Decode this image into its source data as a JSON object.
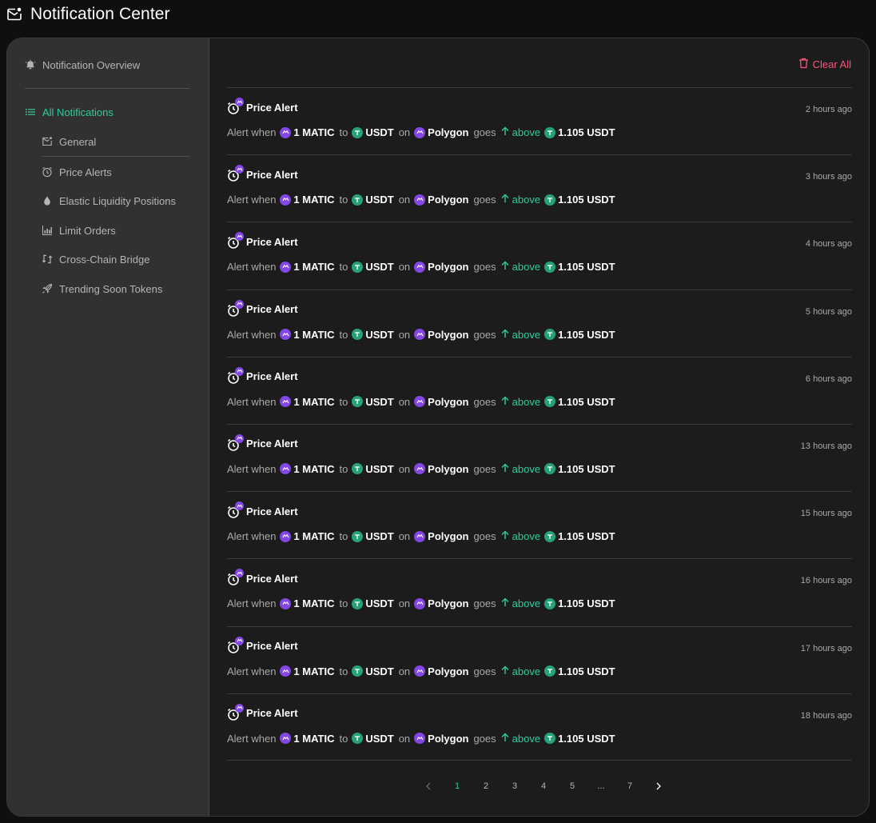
{
  "header": {
    "title": "Notification Center",
    "icon": "mail-badge-icon"
  },
  "sidebar": {
    "overview": {
      "label": "Notification Overview",
      "icon": "bell-icon"
    },
    "all": {
      "label": "All Notifications",
      "icon": "list-icon"
    },
    "items": [
      {
        "label": "General",
        "icon": "mail-icon"
      },
      {
        "label": "Price Alerts",
        "icon": "alarm-icon"
      },
      {
        "label": "Elastic Liquidity Positions",
        "icon": "drop-icon"
      },
      {
        "label": "Limit Orders",
        "icon": "chart-icon"
      },
      {
        "label": "Cross-Chain Bridge",
        "icon": "bridge-icon"
      },
      {
        "label": "Trending Soon Tokens",
        "icon": "rocket-icon"
      }
    ]
  },
  "toolbar": {
    "clear_all": "Clear All"
  },
  "alert_template": {
    "title": "Price Alert",
    "prefix": "Alert when",
    "amount": "1 MATIC",
    "to": "to",
    "quote": "USDT",
    "on": "on",
    "chain": "Polygon",
    "goes": "goes",
    "direction": "above",
    "target": "1.105 USDT"
  },
  "notifications": [
    {
      "time": "2 hours ago"
    },
    {
      "time": "3 hours ago"
    },
    {
      "time": "4 hours ago"
    },
    {
      "time": "5 hours ago"
    },
    {
      "time": "6 hours ago"
    },
    {
      "time": "13 hours ago"
    },
    {
      "time": "15 hours ago"
    },
    {
      "time": "16 hours ago"
    },
    {
      "time": "17 hours ago"
    },
    {
      "time": "18 hours ago"
    }
  ],
  "pagination": {
    "pages": [
      "1",
      "2",
      "3",
      "4",
      "5",
      "...",
      "7"
    ],
    "current": "1"
  },
  "colors": {
    "accent": "#31cb9e",
    "danger": "#ff537b",
    "matic": "#8247e5",
    "usdt": "#26a17b"
  }
}
